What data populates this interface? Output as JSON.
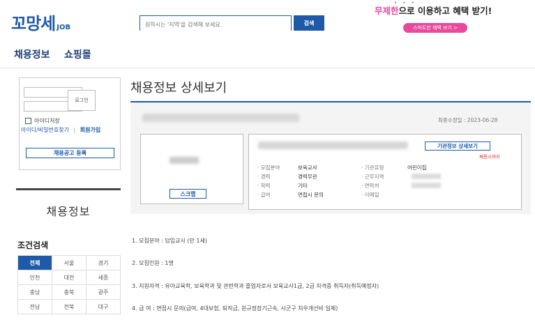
{
  "header": {
    "logo_main": "꼬망세",
    "logo_sub": "JOB",
    "search_placeholder": "원하시는 '지역'을 검색해 보세요.",
    "search_button": "검색",
    "promo_highlight": "무제한",
    "promo_rest": "으로 이용하고 혜택 받기!",
    "promo_button": "스마트한 혜택 보기 >",
    "promo_dots": "• • •"
  },
  "nav": {
    "items": [
      "채용정보",
      "쇼핑몰"
    ]
  },
  "sidebar": {
    "login_button": "로그인",
    "remember_label": "아이디저장",
    "find_links": "아이디/비밀번호찾기",
    "separator": "|",
    "signup": "회원가입",
    "post_job_button": "채용공고 등록",
    "section_title": "채용정보",
    "filter_heading": "조건검색",
    "regions": [
      [
        "전체",
        "서울",
        "경기"
      ],
      [
        "인천",
        "대전",
        "세종"
      ],
      [
        "충남",
        "충북",
        "광주"
      ],
      [
        "전남",
        "전북",
        "대구"
      ]
    ]
  },
  "main": {
    "page_title": "채용정보 상세보기",
    "modified_date": "최종수정일 : 2023-06-28",
    "scrap_button": "스크랩",
    "org_detail_button": "기관정보 상세보기",
    "deadline": "채용시까지",
    "info": {
      "category_label": "· 모집분야",
      "category_value": "보육교사",
      "career_label": "· 경력",
      "career_value": "경력무관",
      "education_label": "· 학력",
      "education_value": "기타",
      "salary_label": "· 급여",
      "salary_value": "면접시 문의",
      "org_type_label": "· 기관유형",
      "org_type_value": "어린이집",
      "work_area_label": "· 근무지역",
      "contact_label": "· 연락처",
      "email_label": "· 이메일"
    },
    "requirements": [
      "1. 모집분야 : 담임교사 (만 1세)",
      "2. 모집인원 : 1명",
      "3. 지원자격 : 유아교육학, 보육학과 및 관련학과 졸업자로서 보육교사1급, 2급 자격증 취득자(취득예정자)",
      "4. 급 여 : 면접시 문의(급여, 4대보험, 퇴직금, 원규정장기근속, 시군구 처우개선비 일체)"
    ]
  },
  "colors": {
    "brand_blue": "#1e5aa8",
    "accent_orange": "#e8612c",
    "promo_pink": "#e8499a",
    "deadline_red": "#e02020"
  }
}
